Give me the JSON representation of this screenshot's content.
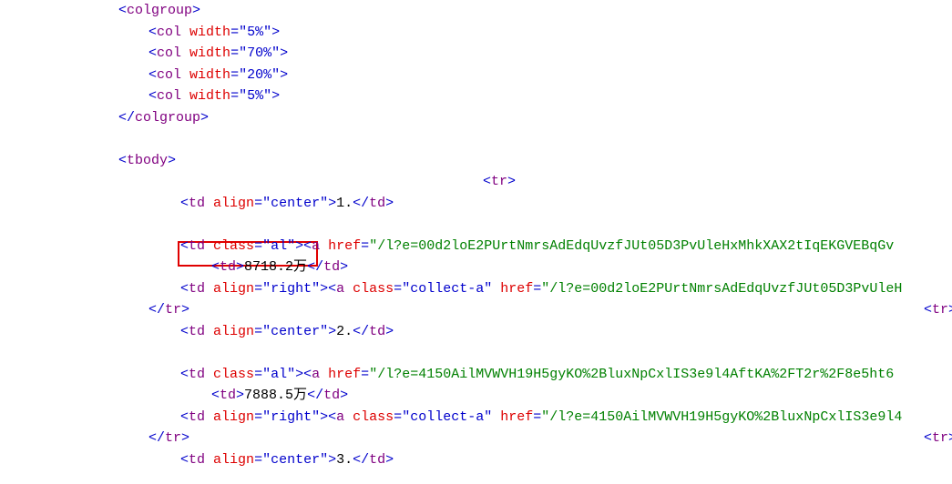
{
  "tags": {
    "colgroup_open": "colgroup",
    "colgroup_close": "colgroup",
    "col": "col",
    "tbody": "tbody",
    "tr": "tr",
    "td": "td",
    "a": "a"
  },
  "attr": {
    "width": "width",
    "align": "align",
    "class": "class",
    "href": "href"
  },
  "vals": {
    "w5": "\"5%\"",
    "w70": "\"70%\"",
    "w20": "\"20%\"",
    "center": "\"center\"",
    "right": "\"right\"",
    "al": "\"al\"",
    "collect_a": "\"collect-a\""
  },
  "text": {
    "n1": "1.",
    "n2": "2.",
    "n3": "3.",
    "amt1": "8718.2万",
    "amt2": "7888.5万"
  },
  "hrefs": {
    "h1a": "\"/l?e=00d2loE2PUrtNmrsAdEdqUvzfJUt05D3PvUleHxMhkXAX2tIqEKGVEBqGv",
    "h1b": "\"/l?e=00d2loE2PUrtNmrsAdEdqUvzfJUt05D3PvUleH",
    "h2a": "\"/l?e=4150AilMVWVH19H5gyKO%2BluxNpCxlIS3e9l4AftKA%2FT2r%2F8e5ht6",
    "h2b": "\"/l?e=4150AilMVWVH19H5gyKO%2BluxNpCxlIS3e9l4"
  },
  "chars": {
    "lt": "<",
    "gt": ">",
    "slash": "/",
    "eq": "="
  }
}
